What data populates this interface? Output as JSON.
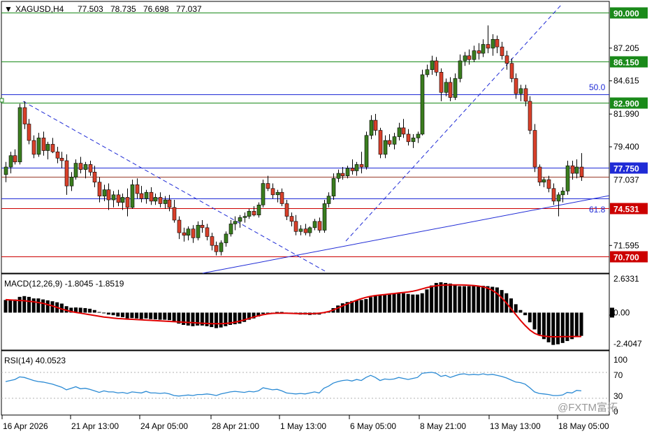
{
  "colors": {
    "background": "#ffffff",
    "bull": "#3a7d1e",
    "bear": "#d9402a",
    "green_level": "#1a8a1a",
    "red_level": "#cc0000",
    "blue_level": "#1f2bd6",
    "trend": "#1f2bd6",
    "macd_hist": "#000000",
    "macd_signal": "#e00000",
    "rsi_line": "#2a8ad4",
    "grid": "#000000"
  },
  "header": {
    "arrow": "▼",
    "symbol": "XAGUSD,H4",
    "open": "77.503",
    "high": "78.735",
    "low": "76.698",
    "close": "77.037"
  },
  "price_axis": {
    "ticks": [
      "87.205",
      "84.615",
      "81.990",
      "79.400",
      "71.595"
    ],
    "current_price": "77.037",
    "ylim": [
      69.4,
      90.9
    ]
  },
  "levels": [
    {
      "label": "90.000",
      "value": 90.0,
      "color": "#1a8a1a",
      "kind": "green_level"
    },
    {
      "label": "86.150",
      "value": 86.15,
      "color": "#1a8a1a",
      "kind": "green_level"
    },
    {
      "label": "82.900",
      "value": 82.9,
      "color": "#1a8a1a",
      "kind": "green_level"
    },
    {
      "label": "77.750",
      "value": 77.75,
      "color": "#1f2bd6",
      "kind": "blue_level"
    },
    {
      "label": "74.531",
      "value": 74.531,
      "color": "#cc0000",
      "kind": "red_level"
    },
    {
      "label": "70.700",
      "value": 70.7,
      "color": "#cc0000",
      "kind": "red_level"
    }
  ],
  "fibo": [
    {
      "label": "50.0",
      "value": 83.55
    },
    {
      "label": "61.8",
      "value": 75.3
    }
  ],
  "macd": {
    "title": "MACD(12,26,9) -1.8045 -1.8519",
    "ticks": [
      "2.6331",
      "0.00",
      "-2.4047"
    ],
    "ylim": [
      -2.9,
      3.0
    ]
  },
  "rsi": {
    "title": "RSI(14) 40.0523",
    "ticks": [
      "100",
      "70",
      "30",
      "0"
    ],
    "levels": [
      70,
      30
    ]
  },
  "time_axis": {
    "labels": [
      "16 Apr 2026",
      "21 Apr 13:00",
      "24 Apr 05:00",
      "28 Apr 21:00",
      "1 May 13:00",
      "6 May 05:00",
      "8 May 21:00",
      "13 May 13:00",
      "18 May 05:00"
    ]
  },
  "watermark": "@FXTM富拓",
  "chart_data": {
    "type": "candlestick",
    "title": "XAGUSD,H4",
    "series": [
      {
        "name": "XAGUSD,H4",
        "ohlc": [
          [
            77.2,
            78.2,
            76.6,
            77.8
          ],
          [
            77.8,
            79.0,
            77.3,
            78.7
          ],
          [
            78.7,
            79.2,
            78.0,
            78.2
          ],
          [
            78.2,
            82.8,
            78.0,
            82.5
          ],
          [
            82.5,
            83.0,
            80.8,
            81.2
          ],
          [
            81.2,
            81.6,
            79.6,
            79.9
          ],
          [
            79.9,
            80.3,
            78.5,
            78.8
          ],
          [
            78.8,
            80.5,
            78.6,
            80.1
          ],
          [
            80.1,
            80.6,
            78.7,
            79.1
          ],
          [
            79.1,
            79.8,
            78.4,
            79.6
          ],
          [
            79.6,
            80.1,
            78.9,
            79.0
          ],
          [
            79.0,
            79.4,
            78.1,
            78.5
          ],
          [
            78.5,
            79.0,
            77.7,
            78.3
          ],
          [
            78.3,
            78.8,
            75.6,
            76.3
          ],
          [
            76.3,
            77.4,
            75.9,
            77.0
          ],
          [
            77.0,
            78.4,
            76.8,
            78.1
          ],
          [
            78.1,
            78.6,
            77.3,
            77.6
          ],
          [
            77.6,
            78.2,
            76.9,
            78.0
          ],
          [
            78.0,
            78.3,
            77.1,
            77.4
          ],
          [
            77.4,
            77.9,
            76.2,
            76.6
          ],
          [
            76.6,
            77.0,
            75.0,
            75.5
          ],
          [
            75.5,
            76.4,
            75.1,
            76.0
          ],
          [
            76.0,
            76.5,
            74.4,
            75.2
          ],
          [
            75.2,
            75.9,
            74.6,
            75.6
          ],
          [
            75.6,
            76.0,
            74.7,
            75.0
          ],
          [
            75.0,
            75.7,
            74.4,
            75.4
          ],
          [
            75.4,
            76.1,
            73.9,
            74.6
          ],
          [
            74.6,
            76.8,
            74.5,
            76.4
          ],
          [
            76.4,
            76.9,
            75.3,
            75.7
          ],
          [
            75.7,
            76.3,
            75.0,
            75.3
          ],
          [
            75.3,
            76.0,
            74.9,
            75.8
          ],
          [
            75.8,
            76.2,
            74.8,
            75.1
          ],
          [
            75.1,
            75.7,
            74.8,
            75.4
          ],
          [
            75.4,
            75.8,
            74.6,
            74.9
          ],
          [
            74.9,
            75.5,
            74.5,
            75.2
          ],
          [
            75.2,
            75.6,
            74.3,
            74.6
          ],
          [
            74.6,
            75.2,
            73.4,
            73.6
          ],
          [
            73.6,
            73.9,
            72.1,
            72.6
          ],
          [
            72.6,
            73.0,
            71.9,
            72.4
          ],
          [
            72.4,
            73.1,
            72.0,
            72.9
          ],
          [
            72.9,
            73.2,
            71.8,
            72.2
          ],
          [
            72.2,
            73.5,
            72.0,
            73.2
          ],
          [
            73.2,
            73.6,
            72.6,
            73.0
          ],
          [
            73.0,
            73.3,
            72.0,
            72.3
          ],
          [
            72.3,
            72.6,
            71.2,
            71.6
          ],
          [
            71.6,
            71.9,
            70.8,
            71.1
          ],
          [
            71.1,
            72.0,
            70.8,
            71.8
          ],
          [
            71.8,
            72.7,
            71.5,
            72.5
          ],
          [
            72.5,
            73.6,
            72.3,
            73.3
          ],
          [
            73.3,
            73.9,
            72.8,
            73.5
          ],
          [
            73.5,
            74.0,
            73.0,
            73.8
          ],
          [
            73.8,
            74.2,
            73.4,
            73.9
          ],
          [
            73.9,
            74.5,
            73.7,
            74.3
          ],
          [
            74.3,
            74.7,
            73.9,
            74.0
          ],
          [
            74.0,
            75.0,
            73.8,
            74.8
          ],
          [
            74.8,
            76.8,
            74.6,
            76.5
          ],
          [
            76.5,
            77.1,
            75.9,
            76.1
          ],
          [
            76.1,
            76.5,
            75.3,
            75.6
          ],
          [
            75.6,
            76.0,
            75.0,
            75.8
          ],
          [
            75.8,
            76.1,
            74.7,
            74.9
          ],
          [
            74.9,
            75.2,
            73.6,
            73.9
          ],
          [
            73.9,
            74.2,
            73.1,
            73.5
          ],
          [
            73.5,
            74.0,
            72.4,
            72.7
          ],
          [
            72.7,
            73.2,
            72.4,
            72.9
          ],
          [
            72.9,
            73.3,
            72.4,
            72.6
          ],
          [
            72.6,
            73.1,
            72.3,
            73.0
          ],
          [
            73.0,
            73.7,
            72.8,
            73.5
          ],
          [
            73.5,
            73.8,
            72.6,
            72.8
          ],
          [
            72.8,
            75.2,
            72.6,
            74.9
          ],
          [
            74.9,
            75.8,
            74.6,
            75.5
          ],
          [
            75.5,
            77.3,
            75.2,
            76.9
          ],
          [
            76.9,
            77.6,
            76.6,
            77.3
          ],
          [
            77.3,
            77.8,
            76.8,
            77.1
          ],
          [
            77.1,
            77.9,
            76.9,
            77.7
          ],
          [
            77.7,
            78.4,
            77.2,
            77.5
          ],
          [
            77.5,
            78.2,
            77.1,
            78.0
          ],
          [
            78.0,
            79.0,
            77.3,
            77.8
          ],
          [
            77.8,
            80.6,
            77.6,
            80.3
          ],
          [
            80.3,
            81.9,
            80.0,
            81.5
          ],
          [
            81.5,
            82.0,
            80.3,
            80.7
          ],
          [
            80.7,
            80.9,
            78.5,
            78.8
          ],
          [
            78.8,
            80.3,
            78.5,
            79.9
          ],
          [
            79.9,
            80.4,
            79.4,
            79.6
          ],
          [
            79.6,
            80.5,
            79.2,
            80.2
          ],
          [
            80.2,
            81.3,
            79.9,
            80.9
          ],
          [
            80.9,
            81.6,
            80.1,
            80.4
          ],
          [
            80.4,
            80.8,
            79.5,
            79.8
          ],
          [
            79.8,
            80.4,
            79.3,
            80.1
          ],
          [
            80.1,
            80.6,
            79.7,
            80.4
          ],
          [
            80.4,
            85.5,
            80.3,
            85.1
          ],
          [
            85.1,
            85.9,
            84.9,
            85.5
          ],
          [
            85.5,
            86.6,
            85.1,
            86.2
          ],
          [
            86.2,
            86.5,
            85.0,
            85.3
          ],
          [
            85.3,
            85.6,
            83.0,
            83.7
          ],
          [
            83.7,
            84.8,
            83.4,
            84.5
          ],
          [
            84.5,
            84.9,
            83.0,
            83.3
          ],
          [
            83.3,
            85.2,
            83.1,
            84.8
          ],
          [
            84.8,
            86.7,
            84.5,
            86.2
          ],
          [
            86.2,
            86.9,
            85.8,
            86.6
          ],
          [
            86.6,
            87.1,
            85.9,
            86.3
          ],
          [
            86.3,
            87.4,
            86.1,
            87.0
          ],
          [
            87.0,
            87.6,
            86.3,
            86.8
          ],
          [
            86.8,
            87.9,
            86.5,
            87.5
          ],
          [
            87.5,
            89.0,
            86.8,
            87.2
          ],
          [
            87.2,
            88.3,
            86.6,
            87.9
          ],
          [
            87.9,
            88.2,
            86.8,
            87.3
          ],
          [
            87.3,
            87.7,
            86.3,
            86.6
          ],
          [
            86.6,
            87.0,
            85.5,
            86.0
          ],
          [
            86.0,
            86.4,
            84.5,
            84.8
          ],
          [
            84.8,
            85.2,
            83.2,
            83.6
          ],
          [
            83.6,
            84.3,
            83.0,
            84.0
          ],
          [
            84.0,
            84.3,
            82.6,
            83.0
          ],
          [
            83.0,
            83.4,
            80.4,
            80.7
          ],
          [
            80.7,
            81.2,
            77.4,
            77.8
          ],
          [
            77.8,
            78.0,
            76.3,
            76.6
          ],
          [
            76.6,
            77.0,
            76.2,
            76.8
          ],
          [
            76.8,
            77.1,
            75.8,
            76.1
          ],
          [
            76.1,
            76.5,
            74.8,
            75.1
          ],
          [
            75.1,
            75.8,
            73.9,
            75.6
          ],
          [
            75.6,
            76.2,
            75.0,
            75.9
          ],
          [
            75.9,
            78.3,
            75.6,
            77.9
          ],
          [
            77.9,
            78.3,
            76.8,
            77.3
          ],
          [
            77.3,
            78.4,
            76.9,
            77.8
          ],
          [
            77.8,
            78.9,
            76.7,
            77.04
          ]
        ]
      }
    ],
    "macd_histogram": [
      0.98,
      1.0,
      1.02,
      1.22,
      1.28,
      1.22,
      1.1,
      1.1,
      1.02,
      0.95,
      0.88,
      0.8,
      0.7,
      0.5,
      0.38,
      0.4,
      0.38,
      0.35,
      0.3,
      0.2,
      0.05,
      -0.05,
      -0.15,
      -0.2,
      -0.3,
      -0.35,
      -0.45,
      -0.42,
      -0.45,
      -0.5,
      -0.45,
      -0.5,
      -0.52,
      -0.55,
      -0.55,
      -0.58,
      -0.7,
      -0.85,
      -0.95,
      -1.0,
      -1.05,
      -1.0,
      -1.0,
      -1.05,
      -1.12,
      -1.2,
      -1.15,
      -1.05,
      -0.95,
      -0.9,
      -0.85,
      -0.72,
      -0.55,
      -0.45,
      -0.3,
      -0.1,
      -0.02,
      0.0,
      0.05,
      0.05,
      0.0,
      -0.05,
      -0.1,
      -0.15,
      -0.15,
      -0.18,
      -0.15,
      -0.15,
      -0.05,
      0.1,
      0.35,
      0.55,
      0.72,
      0.82,
      0.9,
      0.95,
      0.98,
      1.05,
      1.2,
      1.35,
      1.38,
      1.38,
      1.4,
      1.45,
      1.5,
      1.5,
      1.45,
      1.4,
      1.4,
      1.5,
      1.8,
      2.1,
      2.3,
      2.35,
      2.3,
      2.25,
      2.15,
      2.05,
      2.05,
      2.05,
      2.05,
      2.05,
      2.08,
      2.05,
      2.0,
      1.95,
      1.75,
      1.5,
      1.1,
      0.65,
      0.2,
      -0.2,
      -0.75,
      -1.3,
      -1.7,
      -2.05,
      -2.3,
      -2.5,
      -2.45,
      -2.35,
      -2.2,
      -2.05,
      -1.85,
      -1.8
    ],
    "macd_signal": [
      1.0,
      0.98,
      0.96,
      0.94,
      0.92,
      0.88,
      0.84,
      0.78,
      0.72,
      0.62,
      0.52,
      0.4,
      0.28,
      0.18,
      0.08,
      0.02,
      -0.04,
      -0.1,
      -0.16,
      -0.22,
      -0.28,
      -0.34,
      -0.38,
      -0.42,
      -0.46,
      -0.48,
      -0.5,
      -0.52,
      -0.54,
      -0.56,
      -0.58,
      -0.6,
      -0.62,
      -0.64,
      -0.66,
      -0.68,
      -0.7,
      -0.72,
      -0.74,
      -0.76,
      -0.78,
      -0.8,
      -0.82,
      -0.84,
      -0.86,
      -0.86,
      -0.86,
      -0.84,
      -0.8,
      -0.74,
      -0.66,
      -0.56,
      -0.45,
      -0.34,
      -0.24,
      -0.16,
      -0.1,
      -0.06,
      -0.04,
      -0.04,
      -0.05,
      -0.06,
      -0.07,
      -0.08,
      -0.08,
      -0.08,
      -0.07,
      -0.05,
      0.0,
      0.08,
      0.2,
      0.36,
      0.52,
      0.68,
      0.82,
      0.96,
      1.08,
      1.18,
      1.26,
      1.32,
      1.36,
      1.4,
      1.44,
      1.48,
      1.52,
      1.56,
      1.6,
      1.66,
      1.74,
      1.84,
      1.94,
      2.02,
      2.08,
      2.12,
      2.14,
      2.15,
      2.15,
      2.15,
      2.14,
      2.12,
      2.1,
      2.06,
      2.0,
      1.9,
      1.72,
      1.48,
      1.15,
      0.75,
      0.3,
      -0.15,
      -0.6,
      -1.0,
      -1.35,
      -1.6,
      -1.75,
      -1.82,
      -1.86,
      -1.87,
      -1.87,
      -1.86,
      -1.86,
      -1.85,
      -1.85,
      -1.85
    ],
    "rsi": [
      58,
      60,
      62,
      67,
      66,
      63,
      60,
      58,
      57,
      55,
      53,
      50,
      47,
      42,
      45,
      48,
      44,
      45,
      43,
      40,
      37,
      40,
      38,
      38,
      36,
      37,
      35,
      38,
      37,
      36,
      39,
      36,
      36,
      35,
      36,
      34,
      31,
      30,
      31,
      32,
      31,
      33,
      33,
      34,
      33,
      31,
      34,
      36,
      38,
      39,
      38,
      37,
      39,
      38,
      40,
      46,
      44,
      42,
      43,
      40,
      36,
      35,
      34,
      35,
      34,
      36,
      38,
      36,
      45,
      49,
      55,
      58,
      60,
      61,
      59,
      62,
      60,
      66,
      70,
      66,
      60,
      63,
      62,
      63,
      66,
      64,
      62,
      64,
      66,
      74,
      75,
      76,
      74,
      68,
      70,
      66,
      69,
      72,
      73,
      71,
      72,
      71,
      73,
      71,
      72,
      70,
      68,
      65,
      61,
      57,
      56,
      53,
      46,
      38,
      35,
      34,
      33,
      31,
      31,
      32,
      37,
      36,
      41,
      40
    ]
  }
}
